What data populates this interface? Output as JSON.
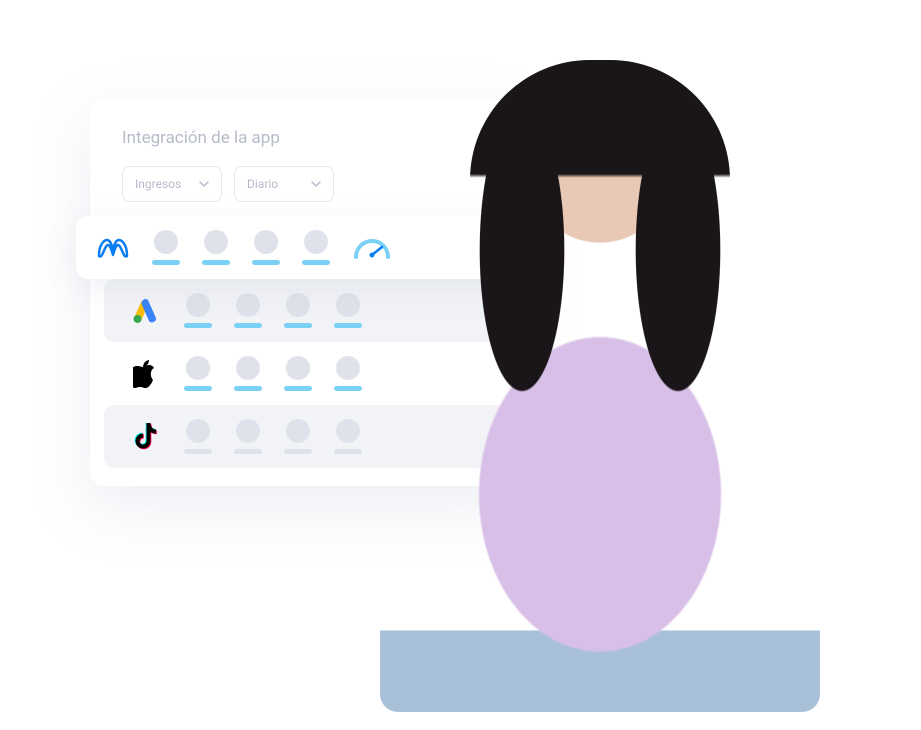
{
  "card": {
    "title": "Integración de la app"
  },
  "filters": {
    "metric": {
      "label": "Ingresos"
    },
    "period": {
      "label": "Diario"
    }
  },
  "rows": [
    {
      "brand": "meta",
      "metrics": [
        {
          "bar_color": "blue"
        },
        {
          "bar_color": "blue"
        },
        {
          "bar_color": "blue"
        },
        {
          "bar_color": "blue"
        },
        {
          "type": "gauge"
        }
      ]
    },
    {
      "brand": "google-ads",
      "metrics": [
        {
          "bar_color": "blue"
        },
        {
          "bar_color": "blue"
        },
        {
          "bar_color": "blue"
        },
        {
          "bar_color": "blue"
        }
      ]
    },
    {
      "brand": "apple",
      "metrics": [
        {
          "bar_color": "blue"
        },
        {
          "bar_color": "blue"
        },
        {
          "bar_color": "blue"
        },
        {
          "bar_color": "blue"
        }
      ]
    },
    {
      "brand": "tiktok",
      "metrics": [
        {
          "bar_color": "grey"
        },
        {
          "bar_color": "grey"
        },
        {
          "bar_color": "grey"
        },
        {
          "bar_color": "grey"
        }
      ]
    }
  ]
}
